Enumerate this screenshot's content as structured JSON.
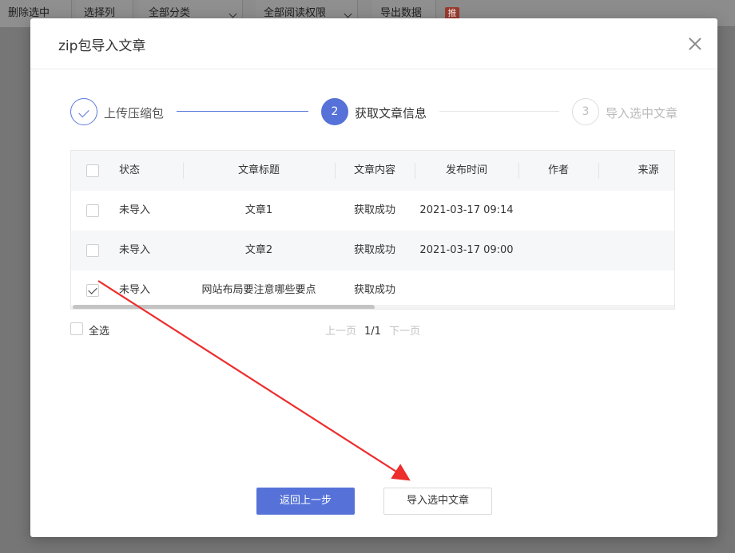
{
  "background": {
    "toolbar": [
      {
        "label": "删除选中",
        "has_dropdown": false
      },
      {
        "label": "选择列",
        "has_dropdown": false
      },
      {
        "label": "全部分类",
        "has_dropdown": true
      },
      {
        "label": "全部阅读权限",
        "has_dropdown": true
      },
      {
        "label": "导出数据",
        "has_dropdown": false
      }
    ],
    "badge": "推"
  },
  "modal": {
    "title": "zip包导入文章",
    "steps": [
      {
        "number": "",
        "label": "上传压缩包",
        "state": "done"
      },
      {
        "number": "2",
        "label": "获取文章信息",
        "state": "active"
      },
      {
        "number": "3",
        "label": "导入选中文章",
        "state": "pending"
      }
    ],
    "table": {
      "headers": {
        "status": "状态",
        "title": "文章标题",
        "content": "文章内容",
        "time": "发布时间",
        "author": "作者",
        "source": "来源"
      },
      "rows": [
        {
          "checked": false,
          "status": "未导入",
          "title": "文章1",
          "content": "获取成功",
          "time": "2021-03-17 09:14",
          "author": "",
          "source": ""
        },
        {
          "checked": false,
          "status": "未导入",
          "title": "文章2",
          "content": "获取成功",
          "time": "2021-03-17 09:00",
          "author": "",
          "source": ""
        },
        {
          "checked": true,
          "status": "未导入",
          "title": "网站布局要注意哪些要点",
          "content": "获取成功",
          "time": "",
          "author": "",
          "source": ""
        }
      ]
    },
    "select_all_label": "全选",
    "pager": {
      "prev": "上一页",
      "current": "1/1",
      "next": "下一页"
    },
    "buttons": {
      "back": "返回上一步",
      "import": "导入选中文章"
    }
  },
  "colors": {
    "accent": "#5672d8",
    "annotation_arrow": "#ee2d2d"
  },
  "icons": [
    "close-icon",
    "check-icon",
    "chevron-down-icon"
  ]
}
